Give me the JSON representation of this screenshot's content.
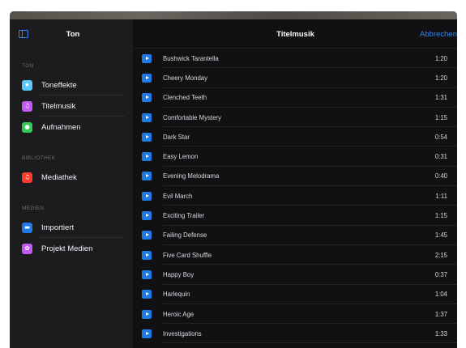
{
  "sidebar": {
    "title": "Ton",
    "sections": [
      {
        "label": "TON",
        "items": [
          {
            "label": "Toneffekte",
            "icon": "star-icon",
            "color": "#5ac8fa",
            "glyph": "★"
          },
          {
            "label": "Titelmusik",
            "icon": "music-note-icon",
            "color": "#bf5af2",
            "glyph": "♫"
          },
          {
            "label": "Aufnahmen",
            "icon": "microphone-icon",
            "color": "#34c759",
            "glyph": "●"
          }
        ]
      },
      {
        "label": "BIBLIOTHEK",
        "items": [
          {
            "label": "Mediathek",
            "icon": "music-library-icon",
            "color": "#ff3b30",
            "glyph": "♫"
          }
        ]
      },
      {
        "label": "MEDIEN",
        "items": [
          {
            "label": "Importiert",
            "icon": "folder-icon",
            "color": "#1f7ae6",
            "glyph": "▬"
          },
          {
            "label": "Projekt Medien",
            "icon": "photos-icon",
            "color": "#bf5af2",
            "glyph": "✿"
          }
        ]
      }
    ]
  },
  "main": {
    "title": "Titelmusik",
    "cancel_label": "Abbrechen",
    "tracks": [
      {
        "name": "Bushwick Tarantella",
        "duration": "1:20"
      },
      {
        "name": "Cheery Monday",
        "duration": "1:20"
      },
      {
        "name": "Clenched Teeth",
        "duration": "1:31"
      },
      {
        "name": "Comfortable Mystery",
        "duration": "1:15"
      },
      {
        "name": "Dark Star",
        "duration": "0:54"
      },
      {
        "name": "Easy Lemon",
        "duration": "0:31"
      },
      {
        "name": "Evening Melodrama",
        "duration": "0:40"
      },
      {
        "name": "Evil March",
        "duration": "1:11"
      },
      {
        "name": "Exciting Trailer",
        "duration": "1:15"
      },
      {
        "name": "Failing Defense",
        "duration": "1:45"
      },
      {
        "name": "Five Card Shuffle",
        "duration": "2:15"
      },
      {
        "name": "Happy Boy",
        "duration": "0:37"
      },
      {
        "name": "Harlequin",
        "duration": "1:04"
      },
      {
        "name": "Heroic Age",
        "duration": "1:37"
      },
      {
        "name": "Investigations",
        "duration": "1:33"
      }
    ]
  },
  "colors": {
    "accent": "#2f87f5",
    "play_button": "#1f7ae6"
  }
}
